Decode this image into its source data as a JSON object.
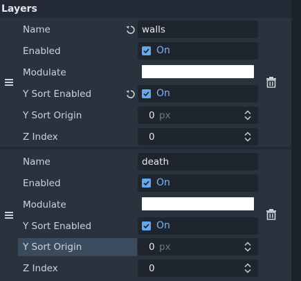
{
  "section": {
    "title": "Layers"
  },
  "field_labels": {
    "name": "Name",
    "enabled": "Enabled",
    "modulate": "Modulate",
    "y_sort_enabled": "Y Sort Enabled",
    "y_sort_origin": "Y Sort Origin",
    "z_index": "Z Index"
  },
  "layers": [
    {
      "name": "walls",
      "enabled_label": "On",
      "y_sort_enabled_label": "On",
      "y_sort_origin": "0",
      "y_sort_origin_unit": "px",
      "z_index": "0",
      "modulate_color": "#ffffff"
    },
    {
      "name": "death",
      "enabled_label": "On",
      "y_sort_enabled_label": "On",
      "y_sort_origin": "0",
      "y_sort_origin_unit": "px",
      "z_index": "0",
      "modulate_color": "#ffffff"
    }
  ],
  "colors": {
    "accent": "#79b3f3",
    "checkbox": "#65a8f0",
    "highlight_row": "#3b4b5e"
  },
  "icons": [
    "revert-icon",
    "drag-handle-icon",
    "trash-icon",
    "spinner-arrows-icon",
    "checkbox-checked-icon"
  ]
}
